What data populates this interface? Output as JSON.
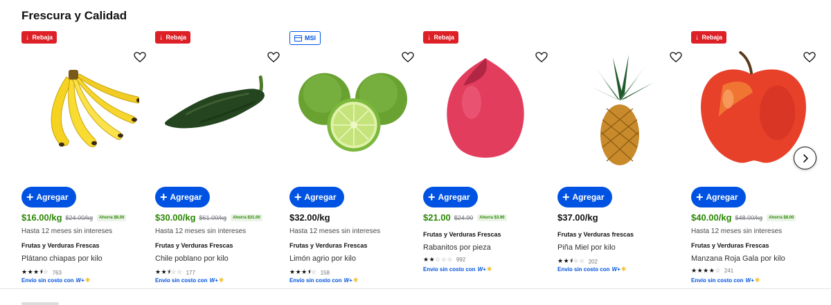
{
  "section": {
    "title": "Frescura y Calidad"
  },
  "common": {
    "add_label": "Agregar",
    "msi_text": "Hasta 12 meses sin intereses",
    "shipping_text": "Envío sin costo con",
    "shipping_brand": "W+"
  },
  "products": [
    {
      "badge": "Rebaja",
      "badge_type": "rebaja",
      "price": "$16.00/kg",
      "price_color": "green",
      "old_price": "$24.00/kg",
      "saving": "Ahorra $8.00",
      "msi": true,
      "category": "Frutas y Verduras Frescas",
      "name": "Plátano chiapas por kilo",
      "rating": 3.5,
      "reviews": "763",
      "shipping": true,
      "image": "bananas"
    },
    {
      "badge": "Rebaja",
      "badge_type": "rebaja",
      "price": "$30.00/kg",
      "price_color": "green",
      "old_price": "$61.00/kg",
      "saving": "Ahorra $31.00",
      "msi": true,
      "category": "Frutas y Verduras Frescas",
      "name": "Chile poblano por kilo",
      "rating": 2.5,
      "reviews": "177",
      "shipping": true,
      "image": "poblano-pepper"
    },
    {
      "badge": "MSI",
      "badge_type": "msi",
      "price": "$32.00/kg",
      "price_color": "black",
      "old_price": "",
      "saving": "",
      "msi": true,
      "category": "Frutas y Verduras Frescas",
      "name": "Limón agrio por kilo",
      "rating": 3.5,
      "reviews": "158",
      "shipping": true,
      "image": "limes"
    },
    {
      "badge": "Rebaja",
      "badge_type": "rebaja",
      "price": "$21.00",
      "price_color": "green",
      "old_price": "$24.90",
      "saving": "Ahorra $3.90",
      "msi": false,
      "category": "Frutas y Verduras Frescas",
      "name": "Rabanitos por pieza",
      "rating": 2,
      "reviews": "992",
      "shipping": true,
      "image": "mango"
    },
    {
      "badge": "",
      "badge_type": "none",
      "price": "$37.00/kg",
      "price_color": "black",
      "old_price": "",
      "saving": "",
      "msi": false,
      "category": "Frutas y Verduras frescas",
      "name": "Piña Miel por kilo",
      "rating": 2.5,
      "reviews": "202",
      "shipping": true,
      "image": "pineapple"
    },
    {
      "badge": "Rebaja",
      "badge_type": "rebaja",
      "price": "$40.00/kg",
      "price_color": "green",
      "old_price": "$48.00/kg",
      "saving": "Ahorra $8.00",
      "msi": true,
      "category": "Frutas y Verduras Frescas",
      "name": "Manzana Roja Gala por kilo",
      "rating": 4,
      "reviews": "241",
      "shipping": true,
      "image": "red-apple"
    }
  ],
  "icons": {
    "heart": "heart-outline-icon",
    "next": "chevron-right-icon",
    "plus": "plus-icon"
  },
  "colors": {
    "primary_blue": "#0053e2",
    "sale_red": "#dd1f26",
    "price_green": "#2a8703"
  }
}
